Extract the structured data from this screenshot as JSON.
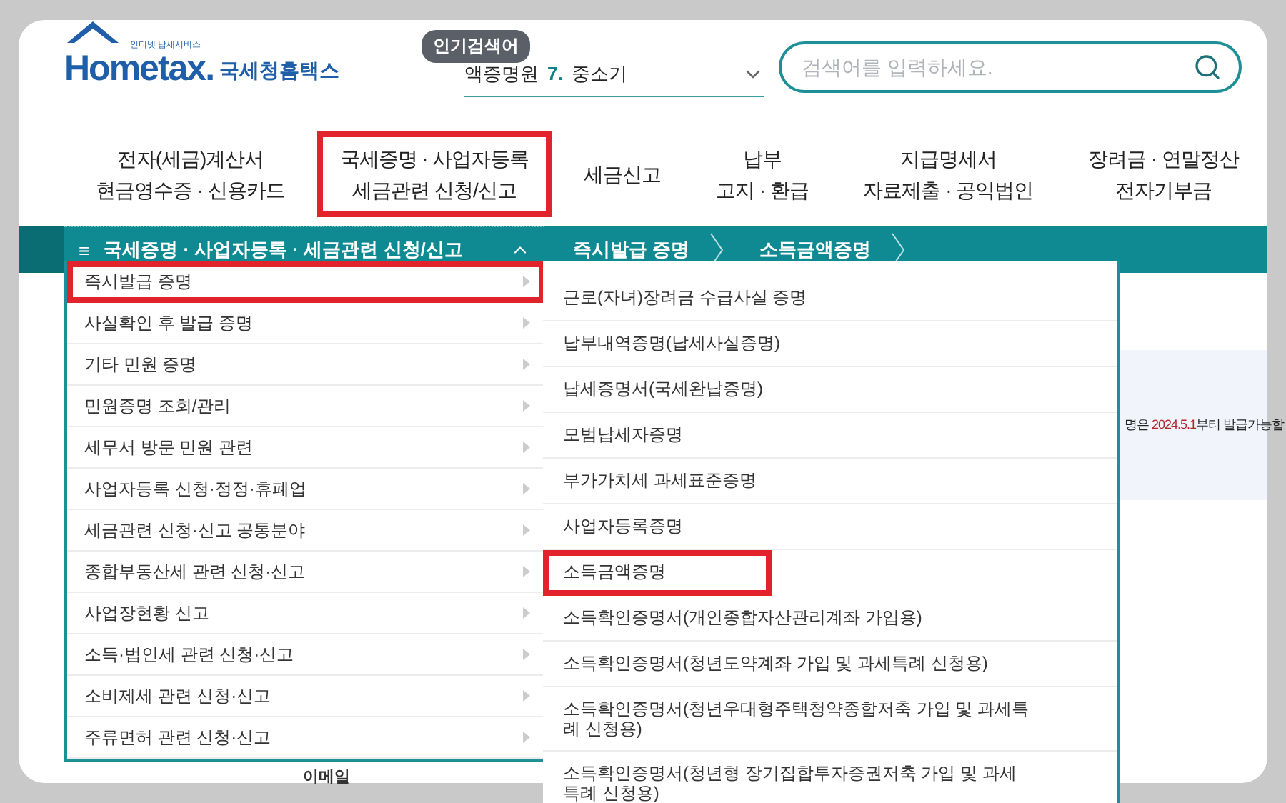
{
  "logo": {
    "tagline": "인터넷 납세서비스",
    "word": "Hometax.",
    "name": "국세청홈택스"
  },
  "popular": {
    "badge": "인기검색어",
    "ticker": [
      {
        "text": "액증명원"
      },
      {
        "rank": "7.",
        "text": "중소기"
      }
    ]
  },
  "search": {
    "placeholder": "검색어를 입력하세요."
  },
  "nav": [
    {
      "lines": [
        "전자(세금)계산서",
        "현금영수증 · 신용카드"
      ],
      "highlighted": false
    },
    {
      "lines": [
        "국세증명 · 사업자등록",
        "세금관련 신청/신고"
      ],
      "highlighted": true
    },
    {
      "lines": [
        "세금신고"
      ],
      "highlighted": false
    },
    {
      "lines": [
        "납부",
        "고지 · 환급"
      ],
      "highlighted": false
    },
    {
      "lines": [
        "지급명세서",
        "자료제출 · 공익법인"
      ],
      "highlighted": false
    },
    {
      "lines": [
        "장려금 · 연말정산",
        "전자기부금"
      ],
      "highlighted": false
    }
  ],
  "breadcrumb": {
    "menu_icon": "≡",
    "menu": "국세증명 · 사업자등록 · 세금관련 신청/신고",
    "expanded": true,
    "steps": [
      "즉시발급 증명",
      "소득금액증명"
    ]
  },
  "submenu": [
    {
      "label": "즉시발급 증명",
      "highlighted": true
    },
    {
      "label": "사실확인 후 발급 증명",
      "highlighted": false
    },
    {
      "label": "기타 민원 증명",
      "highlighted": false
    },
    {
      "label": "민원증명 조회/관리",
      "highlighted": false
    },
    {
      "label": "세무서 방문 민원 관련",
      "highlighted": false
    },
    {
      "label": "사업자등록 신청·정정·휴폐업",
      "highlighted": false
    },
    {
      "label": "세금관련 신청·신고 공통분야",
      "highlighted": false
    },
    {
      "label": "종합부동산세 관련 신청·신고",
      "highlighted": false
    },
    {
      "label": "사업장현황 신고",
      "highlighted": false
    },
    {
      "label": "소득·법인세 관련 신청·신고",
      "highlighted": false
    },
    {
      "label": "소비제세 관련 신청·신고",
      "highlighted": false
    },
    {
      "label": "주류면허 관련 신청·신고",
      "highlighted": false
    }
  ],
  "certificates": [
    {
      "label": "근로(자녀)장려금 수급사실 증명",
      "highlighted": false
    },
    {
      "label": "납부내역증명(납세사실증명)",
      "highlighted": false
    },
    {
      "label": "납세증명서(국세완납증명)",
      "highlighted": false
    },
    {
      "label": "모범납세자증명",
      "highlighted": false
    },
    {
      "label": "부가가치세 과세표준증명",
      "highlighted": false
    },
    {
      "label": "사업자등록증명",
      "highlighted": false
    },
    {
      "label": "소득금액증명",
      "highlighted": true
    },
    {
      "label": "소득확인증명서(개인종합자산관리계좌 가입용)",
      "highlighted": false
    },
    {
      "label": "소득확인증명서(청년도약계좌 가입 및 과세특례 신청용)",
      "highlighted": false
    },
    {
      "label": "소득확인증명서(청년우대형주택청약종합저축 가입 및 과세특례 신청용)",
      "highlighted": false
    },
    {
      "label": "소득확인증명서(청년형 장기집합투자증권저축 가입 및 과세특례 신청용)",
      "highlighted": false
    }
  ],
  "notice": {
    "prefix": "명은",
    "date": "2024.5.1",
    "suffix": "부터 발급가능합"
  },
  "form_label": "이메일"
}
